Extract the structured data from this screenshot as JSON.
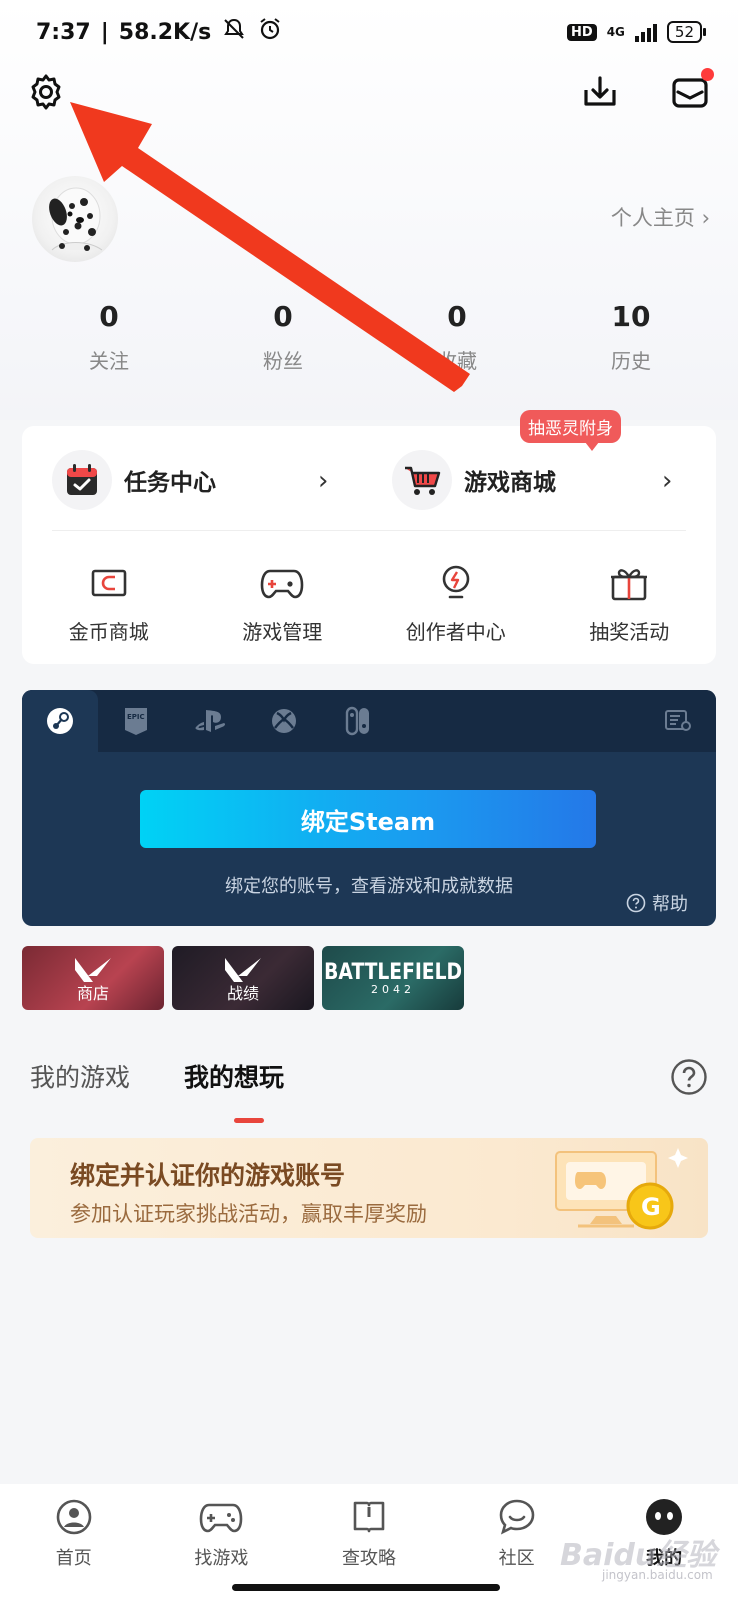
{
  "status_bar": {
    "time": "7:37",
    "speed": "58.2K/s",
    "hd": "HD",
    "network": "4G",
    "battery": "52"
  },
  "header": {
    "icons": [
      "gear-icon",
      "download-icon",
      "mail-icon"
    ]
  },
  "profile": {
    "home_link": "个人主页 ›"
  },
  "stats": [
    {
      "value": "0",
      "label": "关注"
    },
    {
      "value": "0",
      "label": "粉丝"
    },
    {
      "value": "0",
      "label": "收藏"
    },
    {
      "value": "10",
      "label": "历史"
    }
  ],
  "card": {
    "task_center": "任务中心",
    "game_store": "游戏商城",
    "grid": [
      {
        "label": "金币商城",
        "icon": "coin-wallet-icon"
      },
      {
        "label": "游戏管理",
        "icon": "gamepad-icon"
      },
      {
        "label": "创作者中心",
        "icon": "creator-bulb-icon"
      },
      {
        "label": "抽奖活动",
        "icon": "gift-icon"
      }
    ],
    "bubble": "抽恶灵附身"
  },
  "steam": {
    "tabs": [
      "steam-icon",
      "epic-icon",
      "playstation-icon",
      "xbox-icon",
      "switch-icon"
    ],
    "bind_button": "绑定Steam",
    "subtitle": "绑定您的账号，查看游戏和成就数据",
    "help": "帮助"
  },
  "thumbs": [
    {
      "label": "商店"
    },
    {
      "label": "战绩"
    },
    {
      "title": "BATTLEFIELD",
      "sub": "2042"
    }
  ],
  "tabs": {
    "my_games": "我的游戏",
    "my_wishlist": "我的想玩"
  },
  "promo": {
    "title": "绑定并认证你的游戏账号",
    "subtitle": "参加认证玩家挑战活动，赢取丰厚奖励"
  },
  "bottom_nav": [
    {
      "label": "首页"
    },
    {
      "label": "找游戏"
    },
    {
      "label": "查攻略"
    },
    {
      "label": "社区"
    },
    {
      "label": "我的"
    }
  ],
  "watermark": {
    "main": "Baidu经验",
    "sub": "jingyan.baidu.com"
  },
  "colors": {
    "accent_red": "#e8453c",
    "steam_panel": "#1d3755",
    "bind_gradient_start": "#00d2f5",
    "bind_gradient_end": "#2478e8"
  }
}
